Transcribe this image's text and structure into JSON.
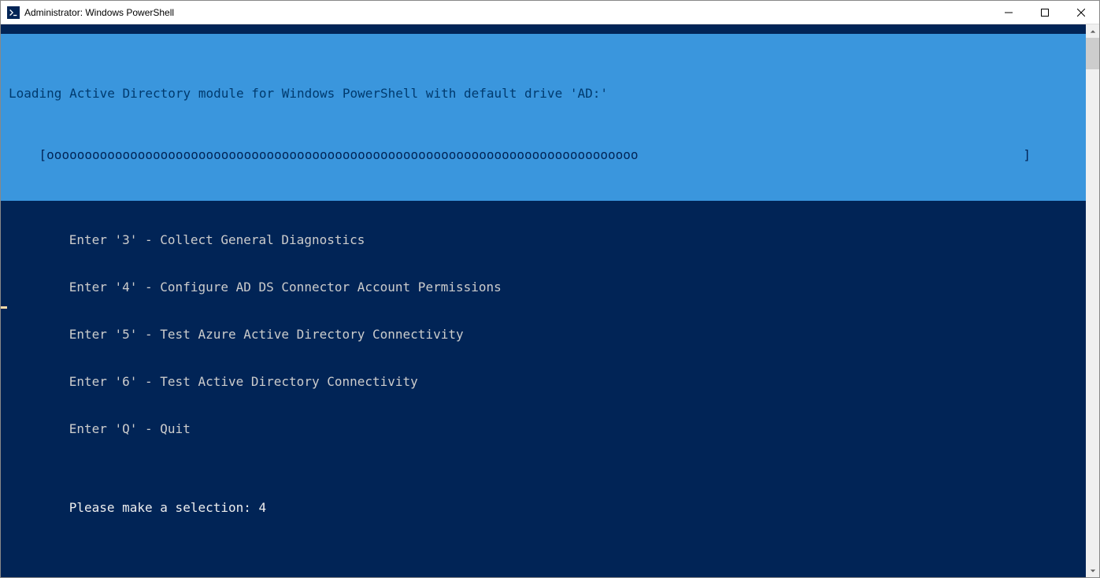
{
  "window": {
    "title": "Administrator: Windows PowerShell"
  },
  "progress": {
    "title": "Loading Active Directory module for Windows PowerShell with default drive 'AD:'",
    "indent": "    [",
    "fill": "oooooooooooooooooooooooooooooooooooooooooooooooooooooooooooooooooooooooooooooo",
    "end": "]"
  },
  "menu": {
    "lines": [
      "         Enter '3' - Collect General Diagnostics",
      "         Enter '4' - Configure AD DS Connector Account Permissions",
      "         Enter '5' - Test Azure Active Directory Connectivity",
      "         Enter '6' - Test Active Directory Connectivity",
      "         Enter 'Q' - Quit"
    ]
  },
  "prompt": {
    "text": "         Please make a selection: 4"
  }
}
